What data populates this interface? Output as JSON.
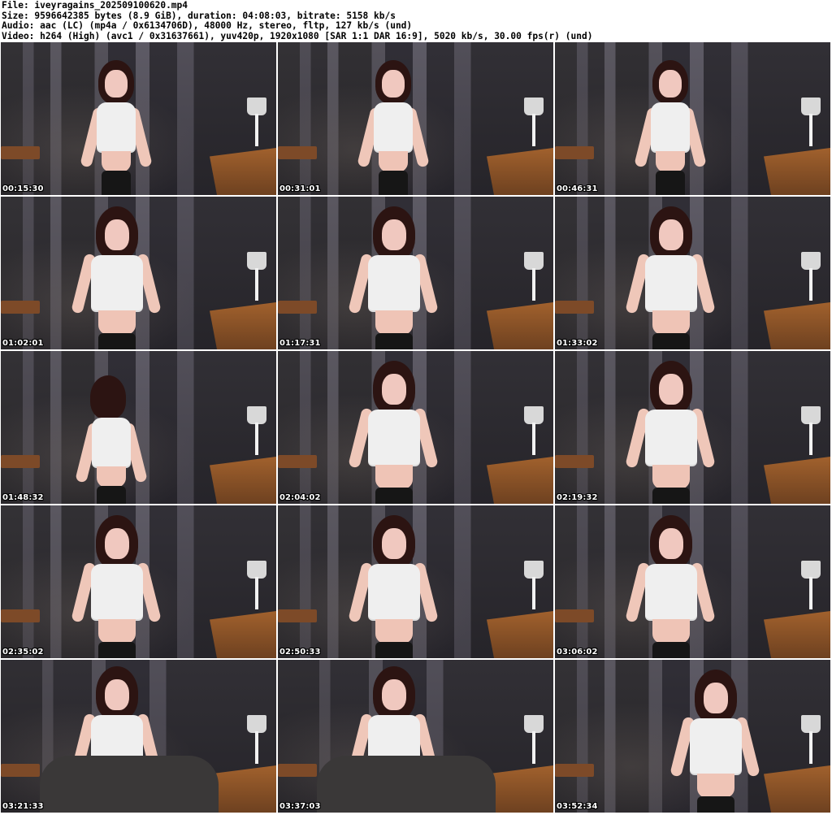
{
  "header": {
    "file": "File: iveyragains_202509100620.mp4",
    "size": "Size: 9596642385 bytes (8.9 GiB), duration: 04:08:03, bitrate: 5158 kb/s",
    "audio": "Audio: aac (LC) (mp4a / 0x6134706D), 48000 Hz, stereo, fltp, 127 kb/s (und)",
    "video": "Video: h264 (High) (avc1 / 0x31637661), yuv420p, 1920x1080 [SAR 1:1 DAR 16:9], 5020 kb/s, 30.00 fps(r) (und)"
  },
  "thumbnails": [
    {
      "timestamp": "00:15:30"
    },
    {
      "timestamp": "00:31:01"
    },
    {
      "timestamp": "00:46:31"
    },
    {
      "timestamp": "01:02:01"
    },
    {
      "timestamp": "01:17:31"
    },
    {
      "timestamp": "01:33:02"
    },
    {
      "timestamp": "01:48:32"
    },
    {
      "timestamp": "02:04:02"
    },
    {
      "timestamp": "02:19:32"
    },
    {
      "timestamp": "02:35:02"
    },
    {
      "timestamp": "02:50:33"
    },
    {
      "timestamp": "03:06:02"
    },
    {
      "timestamp": "03:21:33"
    },
    {
      "timestamp": "03:37:03"
    },
    {
      "timestamp": "03:52:34"
    }
  ]
}
